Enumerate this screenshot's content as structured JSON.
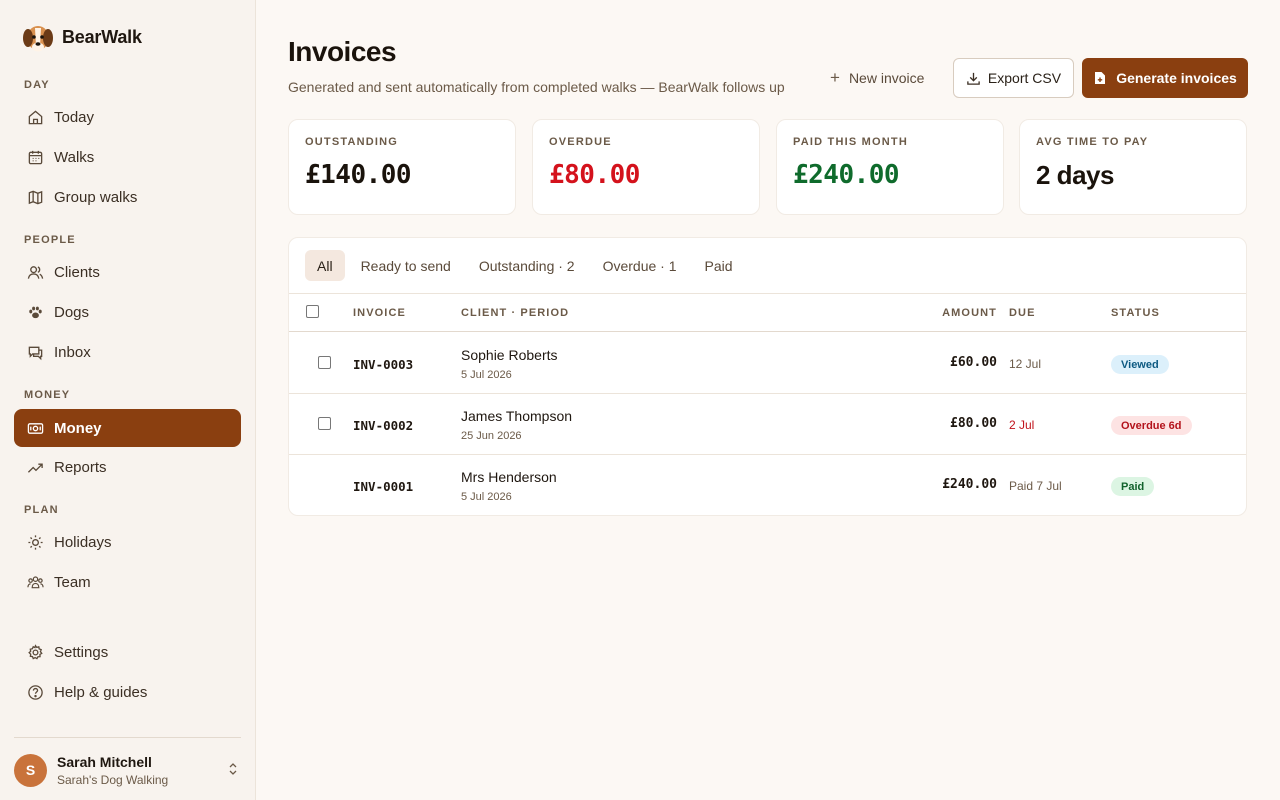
{
  "brand": {
    "name": "BearWalk"
  },
  "sidebar": {
    "sections": {
      "day": "DAY",
      "people": "PEOPLE",
      "money": "MONEY",
      "plan": "PLAN"
    },
    "items": {
      "today": "Today",
      "walks": "Walks",
      "group_walks": "Group walks",
      "clients": "Clients",
      "dogs": "Dogs",
      "inbox": "Inbox",
      "money": "Money",
      "reports": "Reports",
      "holidays": "Holidays",
      "team": "Team",
      "settings": "Settings",
      "help": "Help & guides"
    },
    "active_item": "Money",
    "user": {
      "initial": "S",
      "name": "Sarah Mitchell",
      "business": "Sarah's Dog Walking"
    }
  },
  "header": {
    "title": "Invoices",
    "subtitle": "Generated and sent automatically from completed walks — BearWalk follows up",
    "new_invoice_label": "New invoice",
    "export_label": "Export CSV",
    "generate_label": "Generate invoices"
  },
  "stats": [
    {
      "label": "OUTSTANDING",
      "value": "£140.00",
      "color": "#1a130c"
    },
    {
      "label": "OVERDUE",
      "value": "£80.00",
      "color": "#d4121c"
    },
    {
      "label": "PAID THIS MONTH",
      "value": "£240.00",
      "color": "#0f6b2c"
    },
    {
      "label": "AVG TIME TO PAY",
      "value": "2 days",
      "color": "#1a130c"
    }
  ],
  "tabs": {
    "all": "All",
    "ready": "Ready to send",
    "outstanding": "Outstanding · 2",
    "overdue": "Overdue · 1",
    "paid": "Paid",
    "active": "All"
  },
  "table": {
    "headers": {
      "invoice": "INVOICE",
      "client": "CLIENT · PERIOD",
      "amount": "AMOUNT",
      "due": "DUE",
      "status": "STATUS"
    },
    "rows": [
      {
        "id": "INV-0003",
        "client": "Sophie Roberts",
        "period": "5 Jul 2026",
        "amount": "£60.00",
        "due": "12 Jul",
        "status": "Viewed",
        "selectable": true
      },
      {
        "id": "INV-0002",
        "client": "James Thompson",
        "period": "25 Jun 2026",
        "amount": "£80.00",
        "due": "2 Jul",
        "status": "Overdue 6d",
        "selectable": true
      },
      {
        "id": "INV-0001",
        "client": "Mrs Henderson",
        "period": "5 Jul 2026",
        "amount": "£240.00",
        "due": "Paid 7 Jul",
        "status": "Paid",
        "selectable": false
      }
    ]
  },
  "colors": {
    "accent": "#8a3f10",
    "overdue": "#d4121c",
    "paid": "#0f6b2c",
    "badge_viewed_bg": "#dcf0fb",
    "badge_viewed_fg": "#0d5a82",
    "badge_overdue_bg": "#fde3e3",
    "badge_overdue_fg": "#b3121b",
    "badge_paid_bg": "#dcf5e3",
    "badge_paid_fg": "#11622c"
  }
}
